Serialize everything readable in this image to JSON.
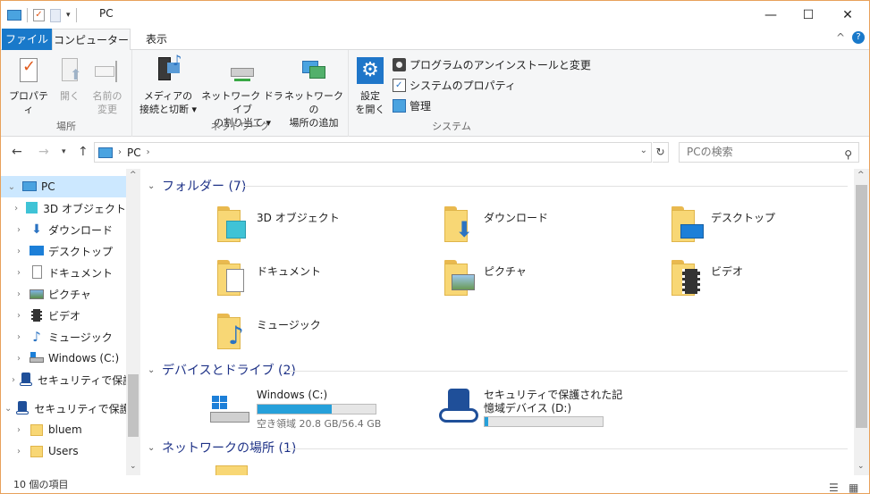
{
  "window": {
    "title": "PC",
    "minimize": "—",
    "maximize": "☐",
    "close": "✕"
  },
  "ribbon_tabs": {
    "file": "ファイル",
    "computer": "コンピューター",
    "view": "表示",
    "help_glyph": "?",
    "collapse_glyph": "^"
  },
  "ribbon": {
    "location_group": {
      "label": "場所",
      "properties": "プロパティ",
      "open": "開く",
      "rename_line1": "名前の",
      "rename_line2": "変更"
    },
    "network_group": {
      "label": "ネットワーク",
      "media_line1": "メディアの",
      "media_line2": "接続と切断 ▾",
      "map_drive_line1": "ネットワーク ドライブ",
      "map_drive_line2": "の割り当て ▾",
      "add_location_line1": "ネットワークの",
      "add_location_line2": "場所の追加"
    },
    "system_group": {
      "label": "システム",
      "settings_line1": "設定",
      "settings_line2": "を開く",
      "uninstall": "プログラムのアンインストールと変更",
      "system_properties": "システムのプロパティ",
      "manage": "管理"
    }
  },
  "address": {
    "path_root": "PC",
    "search_placeholder": "PCの検索"
  },
  "nav": {
    "items": [
      {
        "label": "PC"
      },
      {
        "label": "3D オブジェクト"
      },
      {
        "label": "ダウンロード"
      },
      {
        "label": "デスクトップ"
      },
      {
        "label": "ドキュメント"
      },
      {
        "label": "ピクチャ"
      },
      {
        "label": "ビデオ"
      },
      {
        "label": "ミュージック"
      },
      {
        "label": "Windows (C:)"
      },
      {
        "label": "セキュリティで保護"
      },
      {
        "label": "セキュリティで保護さ"
      },
      {
        "label": "bluem"
      },
      {
        "label": "Users"
      }
    ]
  },
  "content": {
    "folders_header": "フォルダー (7)",
    "folders": [
      {
        "name": "3D オブジェクト"
      },
      {
        "name": "ダウンロード"
      },
      {
        "name": "デスクトップ"
      },
      {
        "name": "ドキュメント"
      },
      {
        "name": "ピクチャ"
      },
      {
        "name": "ビデオ"
      },
      {
        "name": "ミュージック"
      }
    ],
    "devices_header": "デバイスとドライブ (2)",
    "drives": [
      {
        "name": "Windows (C:)",
        "free": "空き領域 20.8 GB/56.4 GB",
        "used_fraction": 0.63
      },
      {
        "name_line1": "セキュリティで保護された記",
        "name_line2": "憶域デバイス (D:)",
        "used_fraction": 0.03
      }
    ],
    "network_header": "ネットワークの場所 (1)"
  },
  "status": {
    "item_count": "10 個の項目"
  },
  "colors": {
    "accent": "#1979ca",
    "selection": "#cce8ff",
    "header_text": "#1e3287",
    "drive_fill": "#26a0da"
  }
}
